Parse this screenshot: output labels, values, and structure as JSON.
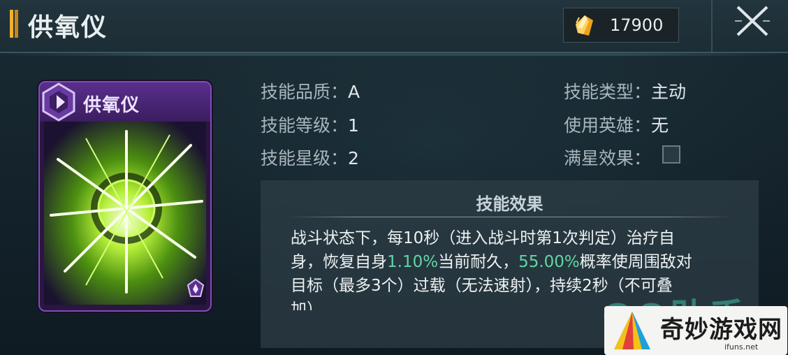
{
  "header": {
    "title": "供氧仪",
    "currency_value": "17900",
    "currency_icon": "crystal-icon",
    "close_icon": "close-icon"
  },
  "card": {
    "name": "供氧仪",
    "type_icon": "hexagon-skill-icon",
    "rank_icon": "rank-badge-icon",
    "border_color": "#7d4fb5"
  },
  "info": {
    "quality_label": "技能品质：",
    "quality_value": "A",
    "level_label": "技能等级：",
    "level_value": "1",
    "star_label": "技能星级：",
    "star_value": "2",
    "type_label": "技能类型：",
    "type_value": "主动",
    "hero_label": "使用英雄：",
    "hero_value": "无",
    "maxstar_label": "满星效果："
  },
  "effect": {
    "title": "技能效果",
    "line1": "战斗状态下，每10秒（进入战斗时第1次判定）治疗自",
    "line2_a": "身，恢复自身",
    "line2_b": "1.10%",
    "line2_c": "当前耐久，",
    "line2_d": "55.00%",
    "line2_e": "概率使周围敌对",
    "line3": "目标（最多3个）过载（无法速射），持续2秒（不可叠",
    "line4": "加）",
    "highlight_color": "#61d6a5"
  },
  "watermark": {
    "qq_text": "QQ助手",
    "site_name": "奇妙游戏网",
    "site_url": "ifuns.net"
  }
}
